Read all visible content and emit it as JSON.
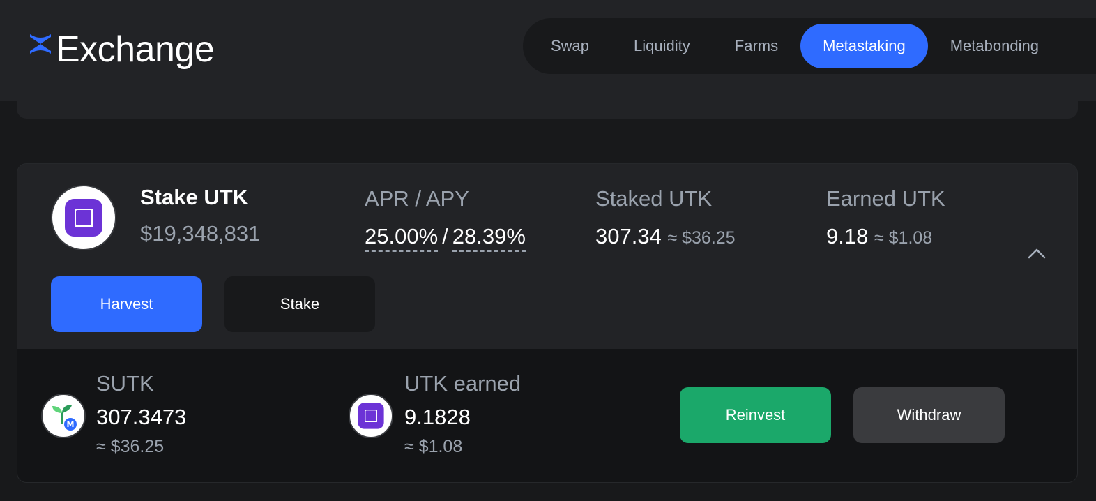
{
  "app": {
    "logo_text": "Exchange",
    "colors": {
      "accent": "#2f6bff",
      "success": "#1ba86a",
      "background": "#18191b",
      "panel": "#222326"
    }
  },
  "nav": {
    "items": [
      {
        "label": "Swap",
        "active": false
      },
      {
        "label": "Liquidity",
        "active": false
      },
      {
        "label": "Farms",
        "active": false
      },
      {
        "label": "Metastaking",
        "active": true
      },
      {
        "label": "Metabonding",
        "active": false
      }
    ]
  },
  "pool": {
    "icon": "utk-token-icon",
    "name": "Stake UTK",
    "tvl": "$19,348,831",
    "apr_label": "APR / APY",
    "apr": "25.00%",
    "apy": "28.39%",
    "staked_label": "Staked UTK",
    "staked_value": "307.34",
    "staked_usd": "≈ $36.25",
    "earned_label": "Earned UTK",
    "earned_value": "9.18",
    "earned_usd": "≈ $1.08",
    "harvest_label": "Harvest",
    "stake_label": "Stake"
  },
  "details": {
    "sutk": {
      "icon": "sutk-token-icon",
      "label": "SUTK",
      "value": "307.3473",
      "usd": "≈ $36.25",
      "badge": "M"
    },
    "utk_earned": {
      "icon": "utk-token-icon",
      "label": "UTK earned",
      "value": "9.1828",
      "usd": "≈ $1.08"
    },
    "reinvest_label": "Reinvest",
    "withdraw_label": "Withdraw"
  }
}
